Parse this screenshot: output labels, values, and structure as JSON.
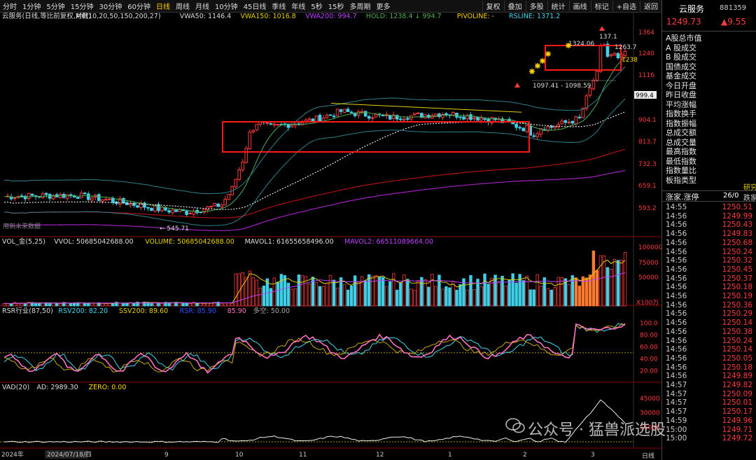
{
  "toolbar": {
    "tabs": [
      "分时",
      "1分钟",
      "5分钟",
      "15分钟",
      "30分钟",
      "60分钟",
      "日线",
      "周线",
      "月线",
      "10分钟",
      "45日线",
      "季线",
      "年线",
      "5秒",
      "15秒",
      "多周期",
      "更多"
    ],
    "active_index": 6,
    "right_buttons": [
      "复权",
      "叠加",
      "多股",
      "统计",
      "画线",
      "标记",
      "+自选",
      "返回"
    ]
  },
  "indicators": {
    "main": {
      "name": "云服务(日线,等比前复权,对数)",
      "m6": "M6(10,20,50,150,200,27)",
      "vwa50": "VWA50: 1146.4",
      "vwa150": "VWA150: 1016.8",
      "vwa200": "VWA200: 994.7",
      "hold": "HOLD: 1238.4 ↓ 994.7",
      "pivoline": "PIVOLINE: -",
      "rsline": "RSLINE: 1371.2"
    },
    "vol": {
      "name": "VOL_金(5,25)",
      "vvol": "VVOL: 50685042688.00",
      "volume": "VOLUME: 50685042688.00",
      "mavol1": "MAVOL1: 61655658496.00",
      "mavol2": "MAVOL2: 66511089664.00"
    },
    "rsr": {
      "name": "RSR行业(87,50)",
      "rsv200": "RSV200: 82.20",
      "ssv200": "SSV200: 89.60",
      "rsr": "RSR: 85.90",
      "rsr2": "85.90",
      "duokong": "多空: 50.00"
    },
    "vad": {
      "name": "VAD(20)",
      "ad": "AD: 2989.30",
      "zero": "ZERO: 0.00"
    }
  },
  "annotations": {
    "future_data": "用到未来数据",
    "low_price": "545.71",
    "range_label": "1097.41 - 1098.59",
    "price_1324": "1324.06",
    "price_1263": "1263.7",
    "price_1238": "1238",
    "price_137": "137.1",
    "vol_unit": "X100万",
    "current_price_tag": "999.4"
  },
  "axis": {
    "price_ticks": [
      "1364",
      "1240",
      "1116",
      "999.4",
      "904.1",
      "813.7",
      "732.3",
      "659.1",
      "593.2"
    ],
    "vol_ticks": [
      "100000",
      "75000",
      "50000"
    ],
    "rsr_ticks": [
      "100.0",
      "80.00",
      "60.00",
      "40.00",
      "20.00"
    ],
    "vad_ticks": [
      "45000",
      "30000",
      "15000"
    ],
    "x_labels": [
      "2024年",
      "2024/07/18/四",
      "9",
      "10",
      "11",
      "12",
      "1",
      "2",
      "3"
    ],
    "period_label": "日线"
  },
  "sidebar": {
    "title": "云服务",
    "code": "881359",
    "price": "1249.73",
    "change": "▲9.55",
    "labels": [
      "A股总市值",
      "A 股成交",
      "B 股成交",
      "国债成交",
      "基金成交",
      "今日开盘",
      "昨日收盘",
      "平均涨幅",
      "指数换手",
      "指数振幅",
      "总成交额",
      "总成交量",
      "最高指数",
      "最低指数",
      "指数量比",
      "板指类型"
    ],
    "board_type_value": "研究",
    "limit_label": "涨家.涨停",
    "limit_value": "26/0",
    "limit_down": "跌家",
    "ticks": [
      {
        "t": "14:55",
        "p": "1250.51"
      },
      {
        "t": "14:56",
        "p": "1249.99"
      },
      {
        "t": "14:56",
        "p": "1250.43"
      },
      {
        "t": "14:56",
        "p": "1249.83"
      },
      {
        "t": "14:56",
        "p": "1250.68"
      },
      {
        "t": "14:56",
        "p": "1250.24"
      },
      {
        "t": "14:56",
        "p": "1250.32"
      },
      {
        "t": "14:56",
        "p": "1250.45"
      },
      {
        "t": "14:56",
        "p": "1250.37"
      },
      {
        "t": "14:56",
        "p": "1250.18"
      },
      {
        "t": "14:56",
        "p": "1250.19"
      },
      {
        "t": "14:56",
        "p": "1250.36"
      },
      {
        "t": "14:56",
        "p": "1250.29"
      },
      {
        "t": "14:56",
        "p": "1250.14"
      },
      {
        "t": "14:56",
        "p": "1250.38"
      },
      {
        "t": "14:56",
        "p": "1250.24"
      },
      {
        "t": "14:56",
        "p": "1250.14"
      },
      {
        "t": "14:56",
        "p": "1250.05"
      },
      {
        "t": "14:56",
        "p": "1250.18"
      },
      {
        "t": "14:56",
        "p": "1249.89"
      },
      {
        "t": "14:57",
        "p": "1249.82"
      },
      {
        "t": "14:57",
        "p": "1250.09"
      },
      {
        "t": "14:57",
        "p": "1250.01"
      },
      {
        "t": "14:57",
        "p": "1250.17"
      },
      {
        "t": "14:59",
        "p": "1249.96"
      },
      {
        "t": "15:00",
        "p": "1249.71"
      },
      {
        "t": "15:00",
        "p": "1249.72"
      }
    ]
  },
  "watermark": "公众号 · 猛兽派选股",
  "colors": {
    "up": "#ff3b3b",
    "down": "#3fd0e8",
    "ma_yellow": "#e6d000",
    "ma_green": "#4caf50",
    "ma_purple": "#a020c0",
    "ma_dark_red": "#b01010",
    "rs_pink": "#ff70c0",
    "rs_cyan": "#40d8f0",
    "box_red": "#ff1a1a"
  }
}
